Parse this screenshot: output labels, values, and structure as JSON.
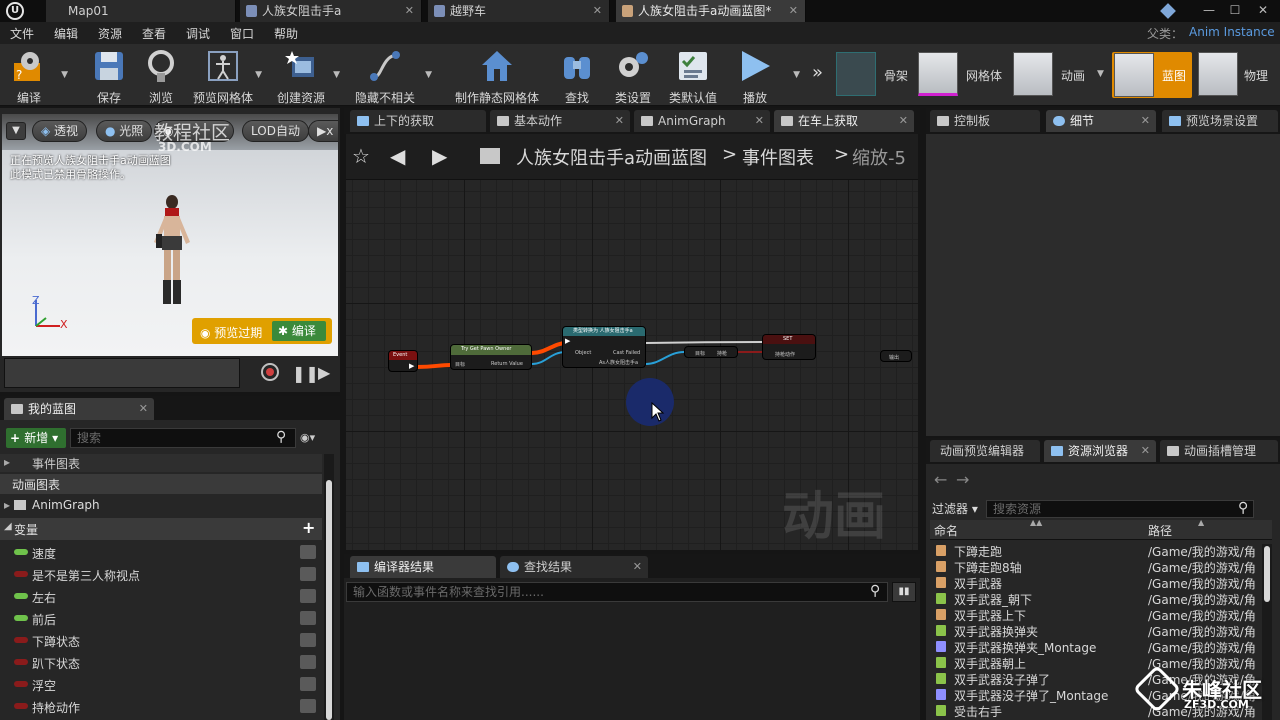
{
  "titlebar": {
    "tabs": [
      {
        "label": "Map01"
      },
      {
        "label": "人族女阻击手a"
      },
      {
        "label": "越野车"
      },
      {
        "label": "人族女阻击手a动画蓝图*"
      }
    ]
  },
  "menubar": {
    "items": [
      "文件",
      "编辑",
      "资源",
      "查看",
      "调试",
      "窗口",
      "帮助"
    ],
    "parent_label": "父类：",
    "parent_value": "Anim Instance"
  },
  "toolbar": {
    "tools": [
      "编译",
      "保存",
      "浏览",
      "预览网格体",
      "创建资源",
      "隐藏不相关",
      "制作静态网格体",
      "查找",
      "类设置",
      "类默认值",
      "播放"
    ],
    "modes": [
      "骨架",
      "网格体",
      "动画",
      "蓝图",
      "物理"
    ]
  },
  "viewport": {
    "buttons": [
      "透视",
      "光照",
      "LOD自动"
    ],
    "info_line1": "正在预览人族女阻击手a动画蓝图",
    "info_line2": "此模式已禁用骨骼操作。",
    "preview_button": "预览过期",
    "compile_button": "编译",
    "axis_z": "Z",
    "axis_x": "X"
  },
  "my_blueprint": {
    "tab_label": "我的蓝图",
    "new_button": "新增",
    "search_placeholder": "搜索",
    "event_graph": "事件图表",
    "anim_graphs_header": "动画图表",
    "anim_graph_item": "AnimGraph",
    "variables_header": "变量",
    "variables": [
      {
        "name": "速度",
        "color": "#6fc24b"
      },
      {
        "name": "是不是第三人称视点",
        "color": "#8a1b1b"
      },
      {
        "name": "左右",
        "color": "#6fc24b"
      },
      {
        "name": "前后",
        "color": "#6fc24b"
      },
      {
        "name": "下蹲状态",
        "color": "#8a1b1b"
      },
      {
        "name": "趴下状态",
        "color": "#8a1b1b"
      },
      {
        "name": "浮空",
        "color": "#8a1b1b"
      },
      {
        "name": "持枪动作",
        "color": "#8a1b1b"
      }
    ]
  },
  "graph_tabs": [
    "上下的获取",
    "基本动作",
    "AnimGraph",
    "在车上获取"
  ],
  "breadcrumb": {
    "root": "人族女阻击手a动画蓝图",
    "sep1": ">",
    "level1": "事件图表",
    "sep2": ">",
    "zoom": "缩放-5"
  },
  "graph": {
    "watermark": "动画",
    "nodes": {
      "event": "Event",
      "try_get": "Try Get Pawn Owner",
      "try_get_target": "目标",
      "try_get_return": "Return Value",
      "cast": "类型转换为 人族女阻击手a",
      "cast_object": "Object",
      "cast_failed": "Cast Failed",
      "cast_as": "As人族女阻击手a",
      "get_target": "目标",
      "get_value": "持枪",
      "set_title": "SET",
      "set_pin": "持枪动作",
      "stray": "输出"
    }
  },
  "bottom_tabs": [
    "编译器结果",
    "查找结果"
  ],
  "find_placeholder": "输入函数或事件名称来查找引用......",
  "right_tabs": [
    "控制板",
    "细节",
    "预览场景设置"
  ],
  "asset_tabs": [
    "动画预览编辑器",
    "资源浏览器",
    "动画插槽管理"
  ],
  "asset_browser": {
    "filter_label": "过滤器",
    "search_placeholder": "搜索资源",
    "col_name": "命名",
    "col_path": "路径",
    "assets": [
      {
        "name": "下蹲走跑",
        "path": "/Game/我的游戏/角",
        "color": "#d9a066"
      },
      {
        "name": "下蹲走跑8轴",
        "path": "/Game/我的游戏/角",
        "color": "#d9a066"
      },
      {
        "name": "双手武器",
        "path": "/Game/我的游戏/角",
        "color": "#d9a066"
      },
      {
        "name": "双手武器_朝下",
        "path": "/Game/我的游戏/角",
        "color": "#8bc34a"
      },
      {
        "name": "双手武器上下",
        "path": "/Game/我的游戏/角",
        "color": "#d9a066"
      },
      {
        "name": "双手武器换弹夹",
        "path": "/Game/我的游戏/角",
        "color": "#8bc34a"
      },
      {
        "name": "双手武器换弹夹_Montage",
        "path": "/Game/我的游戏/角",
        "color": "#8f8fff"
      },
      {
        "name": "双手武器朝上",
        "path": "/Game/我的游戏/角",
        "color": "#8bc34a"
      },
      {
        "name": "双手武器没子弹了",
        "path": "/Game/我的游戏/角",
        "color": "#8bc34a"
      },
      {
        "name": "双手武器没子弹了_Montage",
        "path": "/Game/我的游戏/角",
        "color": "#8f8fff"
      },
      {
        "name": "受击右手",
        "path": "/Game/我的游戏/角",
        "color": "#8bc34a"
      }
    ]
  },
  "watermarks": {
    "top": "教程社区",
    "top_sub": "3D.COM",
    "bottom": "朱峰社区",
    "bottom_sub": "ZF3D.COM"
  }
}
